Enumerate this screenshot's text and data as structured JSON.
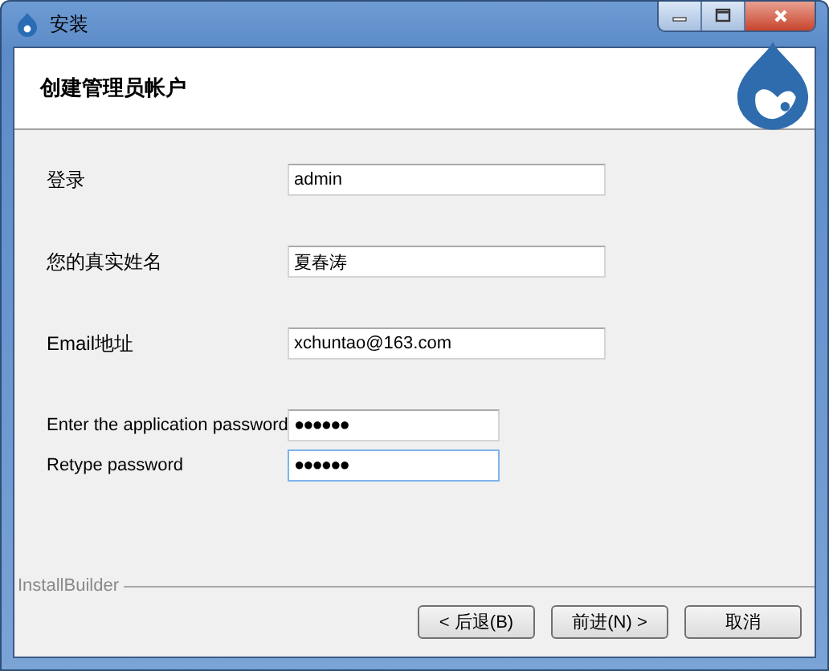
{
  "window": {
    "title": "安装"
  },
  "header": {
    "title": "创建管理员帐户"
  },
  "fields": [
    {
      "label": "登录",
      "value": "admin",
      "kind": "wide",
      "focused": false
    },
    {
      "label": "您的真实姓名",
      "value": "夏春涛",
      "kind": "wide",
      "focused": false
    },
    {
      "label": "Email地址",
      "value": "xchuntao@163.com",
      "kind": "wide",
      "focused": false
    },
    {
      "label": "Enter the application password",
      "value": "●●●●●●",
      "kind": "narrow",
      "focused": false
    },
    {
      "label": "Retype password",
      "value": "●●●●●●",
      "kind": "narrow",
      "focused": true
    }
  ],
  "footer": {
    "brand": "InstallBuilder",
    "buttons": [
      "< 后退(B)",
      "前进(N) >",
      "取消"
    ]
  }
}
